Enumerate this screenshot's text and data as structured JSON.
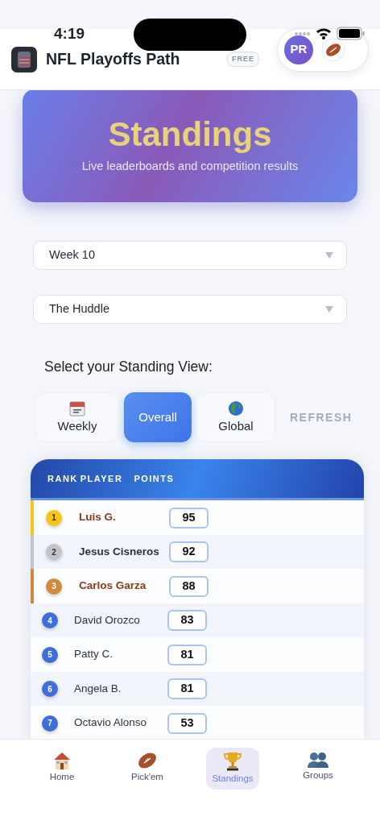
{
  "status_bar": {
    "time": "4:19"
  },
  "header": {
    "title": "NFL Playoffs Path",
    "plan_badge": "FREE",
    "avatar_initials": "PR"
  },
  "hero": {
    "title": "Standings",
    "subtitle": "Live leaderboards and competition results"
  },
  "selects": [
    {
      "value": "Week 10"
    },
    {
      "value": "The Huddle"
    }
  ],
  "view_prompt": "Select your Standing View:",
  "view_tabs": [
    {
      "label": "Weekly",
      "selected": false
    },
    {
      "label": "Overall",
      "selected": true
    },
    {
      "label": "Global",
      "selected": false
    }
  ],
  "refresh": {
    "label": "REFRESH",
    "disabled": true
  },
  "table": {
    "columns": [
      "RANK",
      "PLAYER",
      "POINTS"
    ],
    "rows": [
      {
        "rank": "1",
        "player": "Luis G.",
        "points": "95",
        "kind": "podium",
        "color": "#f5c518",
        "highlight": true
      },
      {
        "rank": "2",
        "player": "Jesus Cisneros",
        "points": "92",
        "kind": "podium",
        "color": "#c4c4c8",
        "highlight": false
      },
      {
        "rank": "3",
        "player": "Carlos Garza",
        "points": "88",
        "kind": "podium",
        "color": "#d08a3e",
        "highlight": true
      },
      {
        "rank": "4",
        "player": "David Orozco",
        "points": "83",
        "kind": "regular",
        "color": "#3f6ed8",
        "highlight": false
      },
      {
        "rank": "5",
        "player": "Patty C.",
        "points": "81",
        "kind": "regular",
        "color": "#3f6ed8",
        "highlight": false
      },
      {
        "rank": "6",
        "player": "Angela B.",
        "points": "81",
        "kind": "regular",
        "color": "#3f6ed8",
        "highlight": false
      },
      {
        "rank": "7",
        "player": "Octavio Alonso",
        "points": "53",
        "kind": "regular",
        "color": "#3f6ed8",
        "highlight": false
      }
    ]
  },
  "bottom_nav": [
    {
      "label": "Home",
      "selected": false
    },
    {
      "label": "Pick'em",
      "selected": false
    },
    {
      "label": "Standings",
      "selected": true
    },
    {
      "label": "Groups",
      "selected": false
    }
  ]
}
